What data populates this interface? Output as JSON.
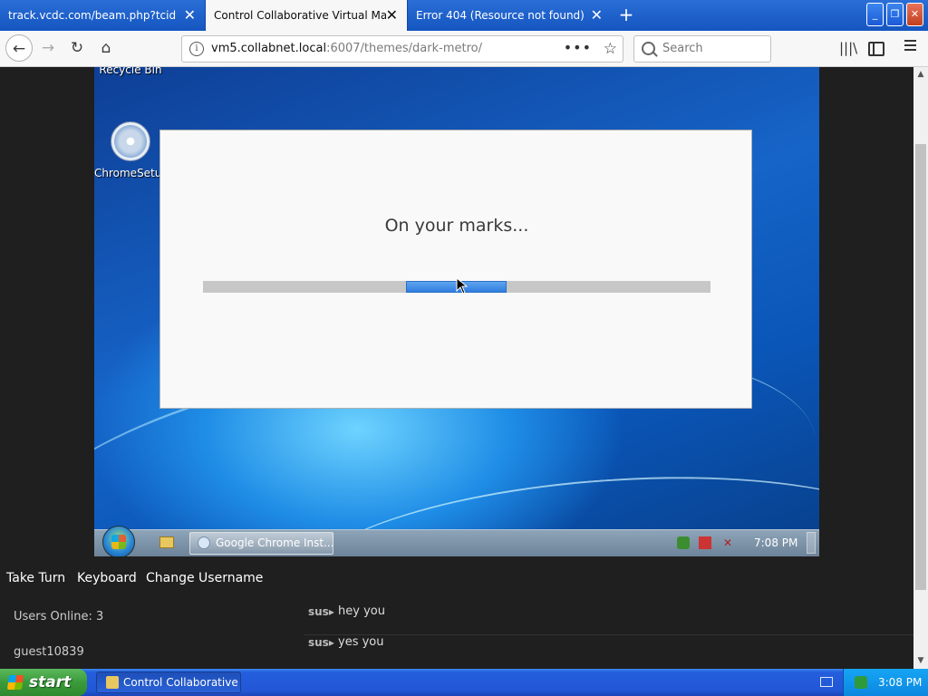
{
  "browser": {
    "tabs": [
      {
        "label": "track.vcdc.com/beam.php?tcid=&targ",
        "active": false
      },
      {
        "label": "Control Collaborative Virtual Machines!",
        "active": true
      },
      {
        "label": "Error 404 (Resource not found)",
        "active": false
      }
    ],
    "new_tab_label": "+",
    "url": {
      "host": "vm5.collabnet.local",
      "rest": ":6007/themes/dark-metro/"
    },
    "search_placeholder": "Search"
  },
  "vm": {
    "desktop_icons": [
      {
        "label": "Recycle Bin"
      },
      {
        "label": "ChromeSetu..."
      }
    ],
    "dialog": {
      "message": "On your marks...",
      "progress_fraction": 0.2
    },
    "taskbar": {
      "task_label": "Google Chrome Inst...",
      "clock": "7:08 PM"
    }
  },
  "controls": {
    "take_turn": "Take Turn",
    "keyboard": "Keyboard",
    "change_username": "Change Username"
  },
  "users": {
    "online_label": "Users Online: 3",
    "list": [
      "guest10839"
    ]
  },
  "chat": [
    {
      "user": "sus",
      "message": "hey you"
    },
    {
      "user": "sus",
      "message": "yes you"
    }
  ],
  "xp_taskbar": {
    "start_label": "start",
    "task_label": "Control Collaborative ...",
    "clock": "3:08 PM"
  },
  "colors": {
    "firefox_tab_blue": "#1555c0",
    "page_bg": "#1f1f1f",
    "progress_blue": "#2f7de0",
    "xp_taskbar": "#2257d7",
    "xp_start_green": "#3a9a3a"
  }
}
